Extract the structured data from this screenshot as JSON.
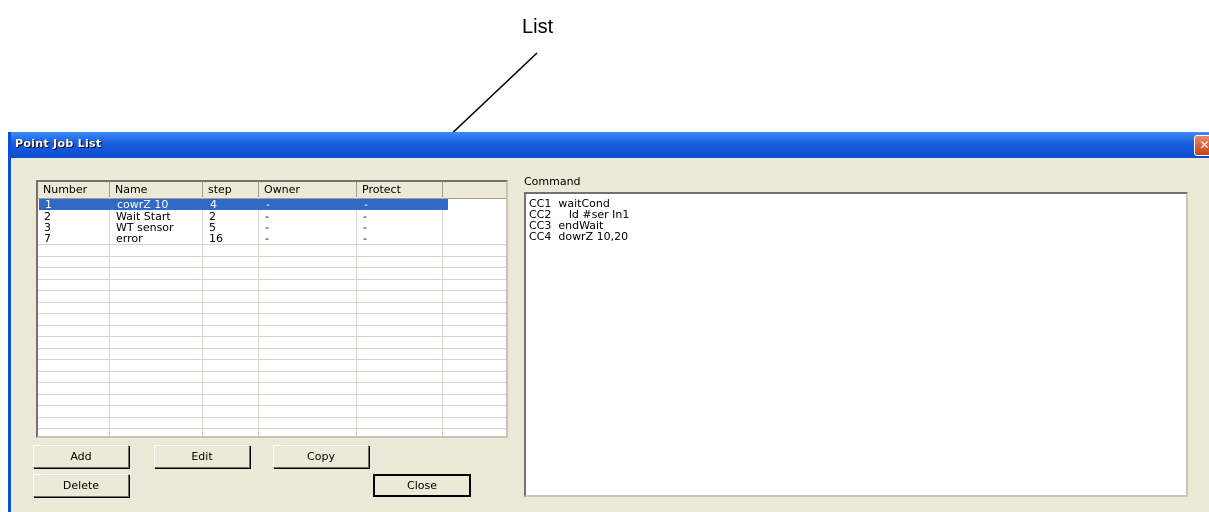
{
  "annotation": {
    "top_label": "List"
  },
  "window": {
    "title": "Point Job List",
    "close_glyph": "✕"
  },
  "list": {
    "columns": [
      "Number",
      "Name",
      "step",
      "Owner",
      "Protect"
    ],
    "rows": [
      [
        "1",
        "cowrZ 10",
        "4",
        "-",
        "-"
      ],
      [
        "2",
        "Wait Start",
        "2",
        "-",
        "-"
      ],
      [
        "3",
        "WT sensor",
        "5",
        "-",
        "-"
      ],
      [
        "7",
        "error",
        "16",
        "-",
        "-"
      ]
    ],
    "selected_index": 0
  },
  "command": {
    "label": "Command",
    "lines": [
      "CC1  waitCond",
      "CC2     ld #ser In1",
      "CC3  endWait",
      "CC4  dowrZ 10,20"
    ]
  },
  "buttons": {
    "add": "Add",
    "edit": "Edit",
    "copy": "Copy",
    "delete": "Delete",
    "close": "Close"
  },
  "colors": {
    "selection": "#316ac5",
    "titlebar": "#0a4cd0",
    "face": "#ece9d8"
  }
}
